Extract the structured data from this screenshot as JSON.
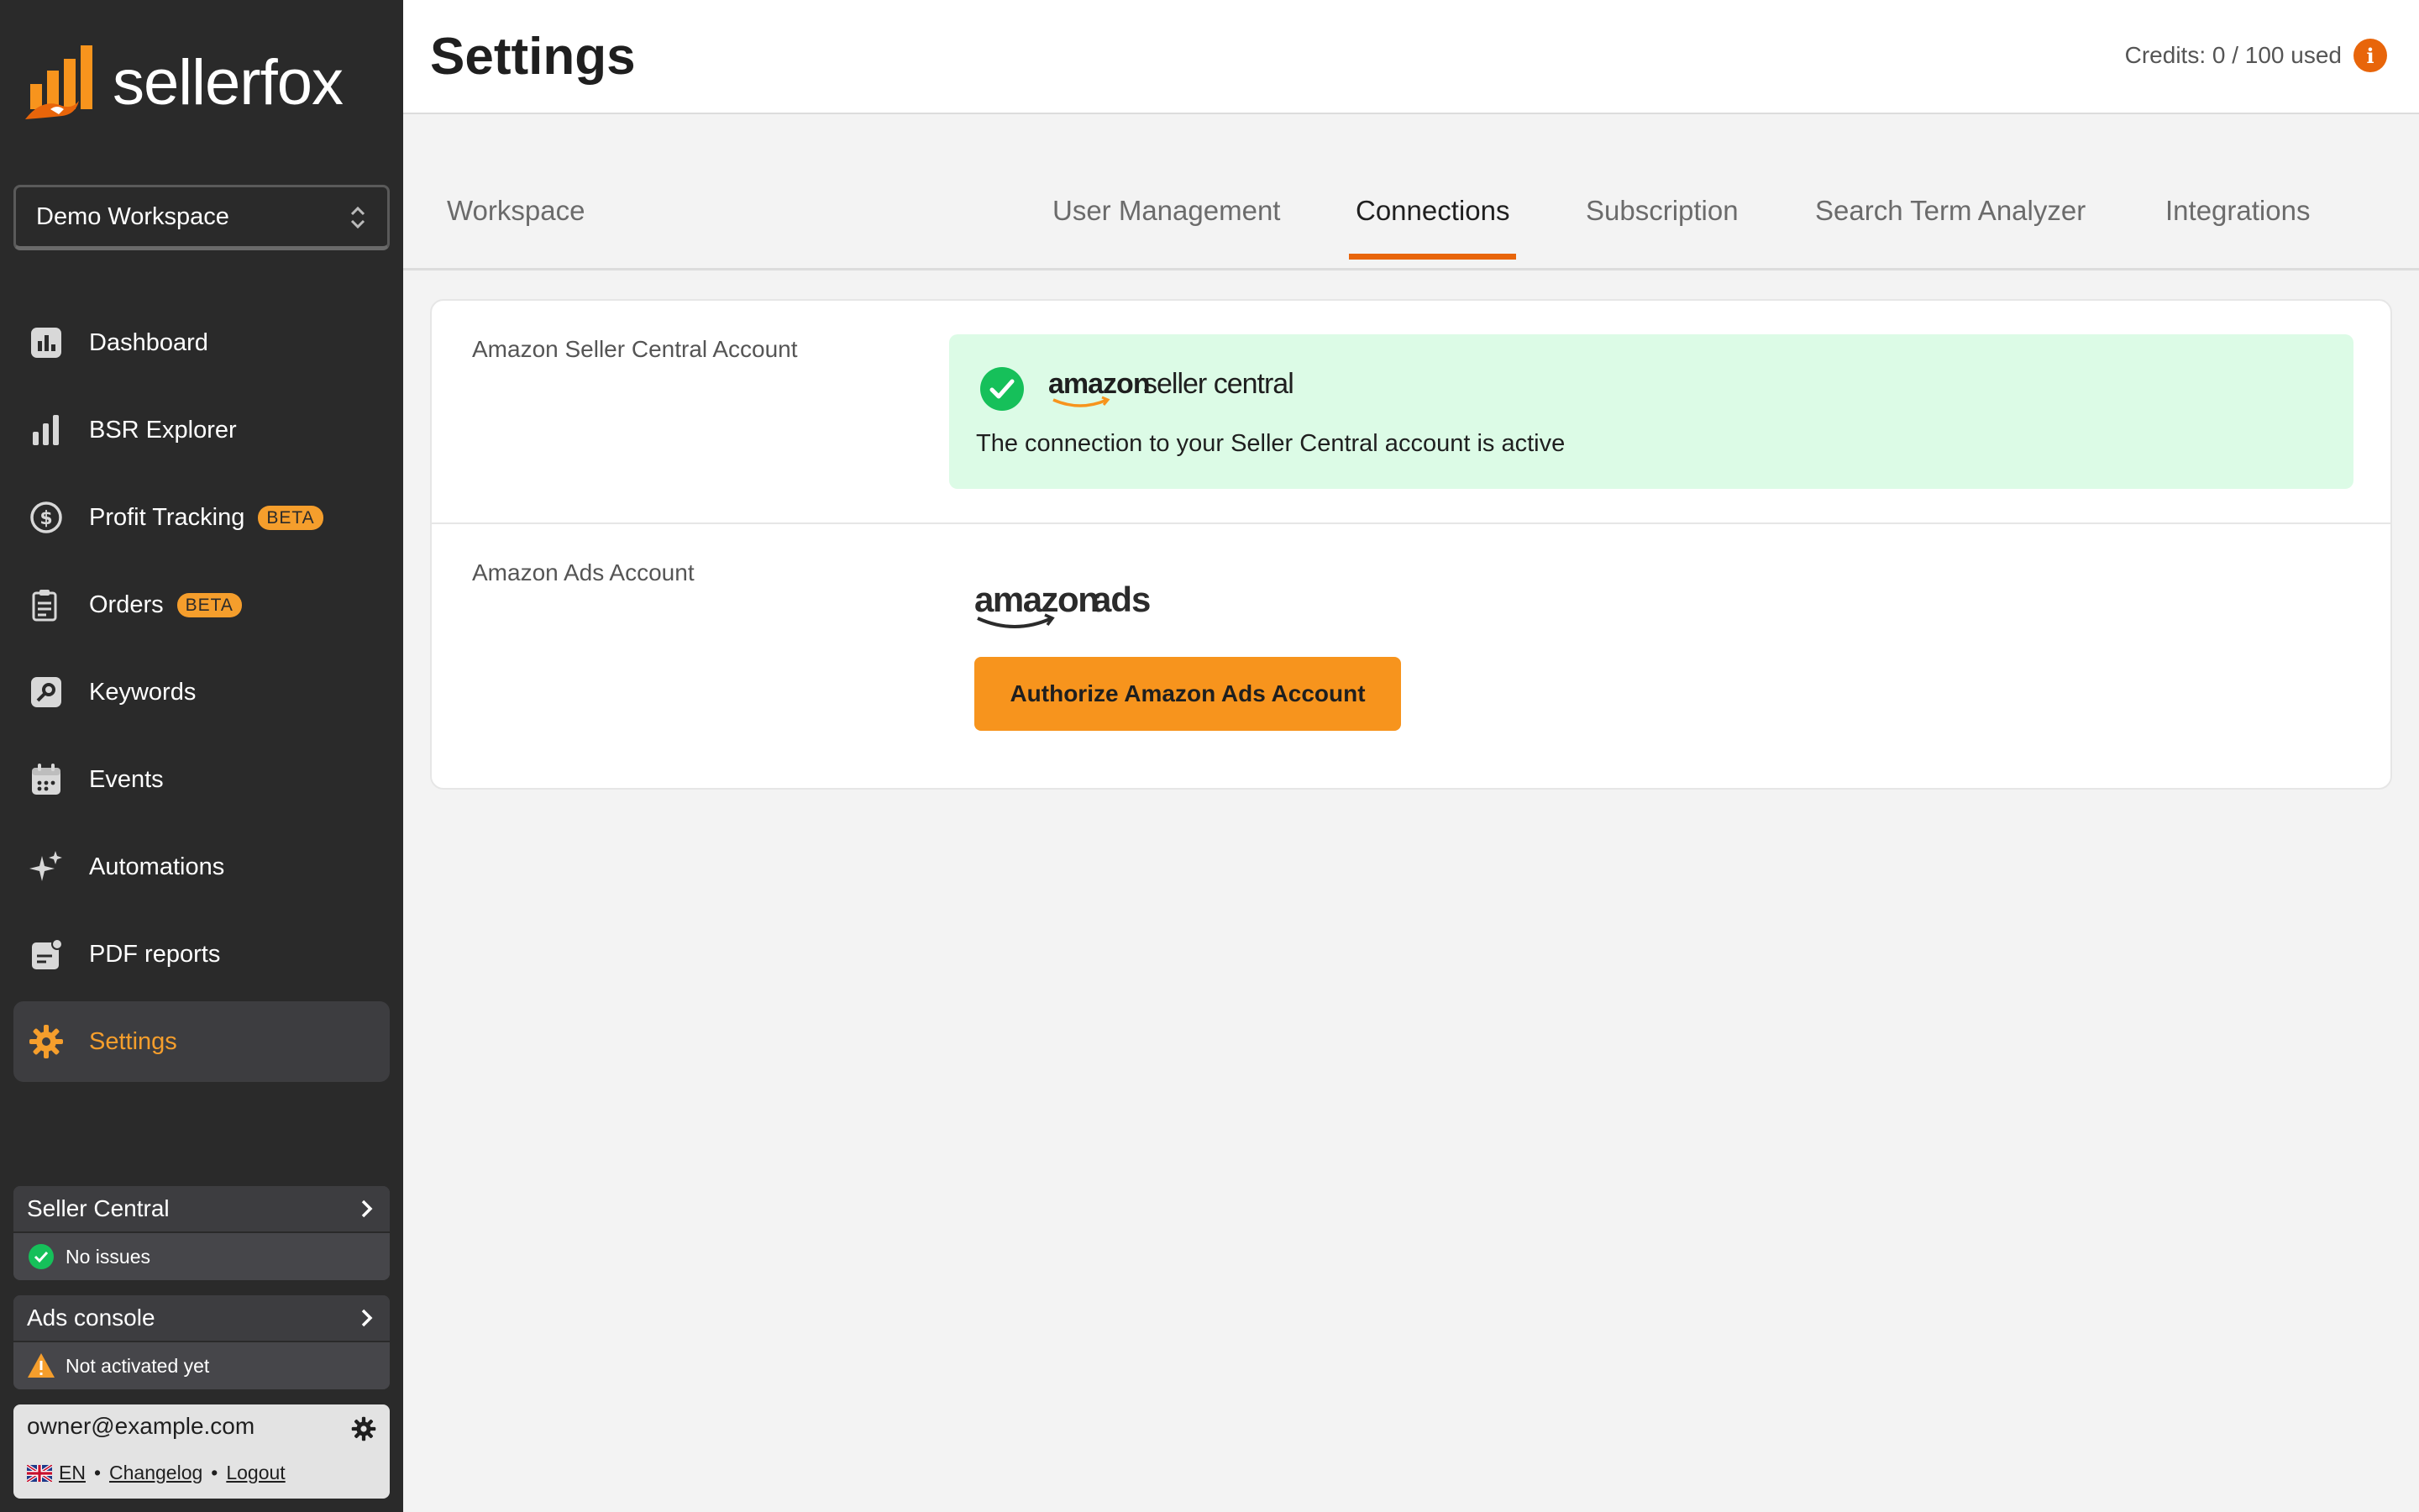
{
  "brand": {
    "name": "sellerfox"
  },
  "workspace": {
    "selected": "Demo Workspace"
  },
  "nav": [
    {
      "label": "Dashboard",
      "icon": "dashboard-icon"
    },
    {
      "label": "BSR Explorer",
      "icon": "bar-chart-icon"
    },
    {
      "label": "Profit Tracking",
      "icon": "dollar-icon",
      "badge": "BETA"
    },
    {
      "label": "Orders",
      "icon": "clipboard-icon",
      "badge": "BETA"
    },
    {
      "label": "Keywords",
      "icon": "key-icon"
    },
    {
      "label": "Events",
      "icon": "calendar-icon"
    },
    {
      "label": "Automations",
      "icon": "sparkles-icon"
    },
    {
      "label": "PDF reports",
      "icon": "report-icon"
    },
    {
      "label": "Settings",
      "icon": "gear-icon",
      "active": true
    }
  ],
  "status": {
    "seller_central": {
      "title": "Seller Central",
      "status": "No issues"
    },
    "ads_console": {
      "title": "Ads console",
      "status": "Not activated yet"
    }
  },
  "user": {
    "email": "owner@example.com",
    "language": "EN",
    "changelog": "Changelog",
    "logout": "Logout",
    "separator": "•"
  },
  "header": {
    "title": "Settings",
    "credits": "Credits: 0 / 100 used",
    "info": "i"
  },
  "tabs": [
    {
      "label": "Workspace"
    },
    {
      "label": "User Management"
    },
    {
      "label": "Connections",
      "active": true
    },
    {
      "label": "Subscription"
    },
    {
      "label": "Search Term Analyzer"
    },
    {
      "label": "Integrations"
    }
  ],
  "connections": {
    "seller_central": {
      "label": "Amazon Seller Central Account",
      "logo_bold": "amazon",
      "logo_light": "seller central",
      "message": "The connection to your Seller Central account is active"
    },
    "ads": {
      "label": "Amazon Ads Account",
      "logo_bold": "amazon",
      "logo_light": "ads",
      "button": "Authorize Amazon Ads Account"
    }
  },
  "colors": {
    "accent": "#f59e2c",
    "tab_underline": "#e8650a",
    "sidebar_bg": "#2a2a2a",
    "success_bg": "#dcfbe6",
    "success": "#16c05a",
    "warning": "#f59e2c"
  }
}
